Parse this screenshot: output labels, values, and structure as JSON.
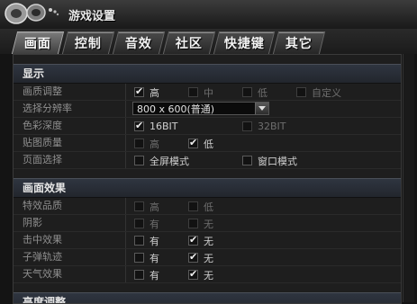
{
  "window": {
    "title": "游戏设置"
  },
  "tabs": [
    {
      "label": "画面",
      "active": true
    },
    {
      "label": "控制",
      "active": false
    },
    {
      "label": "音效",
      "active": false
    },
    {
      "label": "社区",
      "active": false
    },
    {
      "label": "快捷键",
      "active": false
    },
    {
      "label": "其它",
      "active": false
    }
  ],
  "sections": {
    "display": {
      "title": "显示",
      "rows": {
        "quality": {
          "label": "画质调整",
          "options": [
            {
              "label": "高",
              "checked": true
            },
            {
              "label": "中",
              "checked": false
            },
            {
              "label": "低",
              "checked": false
            },
            {
              "label": "自定义",
              "checked": false
            }
          ]
        },
        "resolution": {
          "label": "选择分辨率",
          "value": "800 x 600(普通)"
        },
        "color_depth": {
          "label": "色彩深度",
          "options": [
            {
              "label": "16BIT",
              "checked": true
            },
            {
              "label": "32BIT",
              "checked": false
            }
          ]
        },
        "texture": {
          "label": "贴图质量",
          "options": [
            {
              "label": "高",
              "checked": false
            },
            {
              "label": "低",
              "checked": true
            }
          ]
        },
        "page": {
          "label": "页面选择",
          "options": [
            {
              "label": "全屏模式",
              "checked": false
            },
            {
              "label": "窗口模式",
              "checked": false
            }
          ]
        }
      }
    },
    "effects": {
      "title": "画面效果",
      "rows": {
        "fx_quality": {
          "label": "特效品质",
          "options": [
            {
              "label": "高",
              "checked": false
            },
            {
              "label": "低",
              "checked": false
            }
          ]
        },
        "shadow": {
          "label": "阴影",
          "options": [
            {
              "label": "有",
              "checked": false
            },
            {
              "label": "无",
              "checked": false
            }
          ]
        },
        "hit_effect": {
          "label": "击中效果",
          "options": [
            {
              "label": "有",
              "checked": false
            },
            {
              "label": "无",
              "checked": true
            }
          ]
        },
        "bullet_trail": {
          "label": "子弹轨迹",
          "options": [
            {
              "label": "有",
              "checked": false
            },
            {
              "label": "无",
              "checked": true
            }
          ]
        },
        "weather": {
          "label": "天气效果",
          "options": [
            {
              "label": "有",
              "checked": false
            },
            {
              "label": "无",
              "checked": true
            }
          ]
        }
      }
    },
    "brightness": {
      "title": "亮度调整"
    }
  }
}
